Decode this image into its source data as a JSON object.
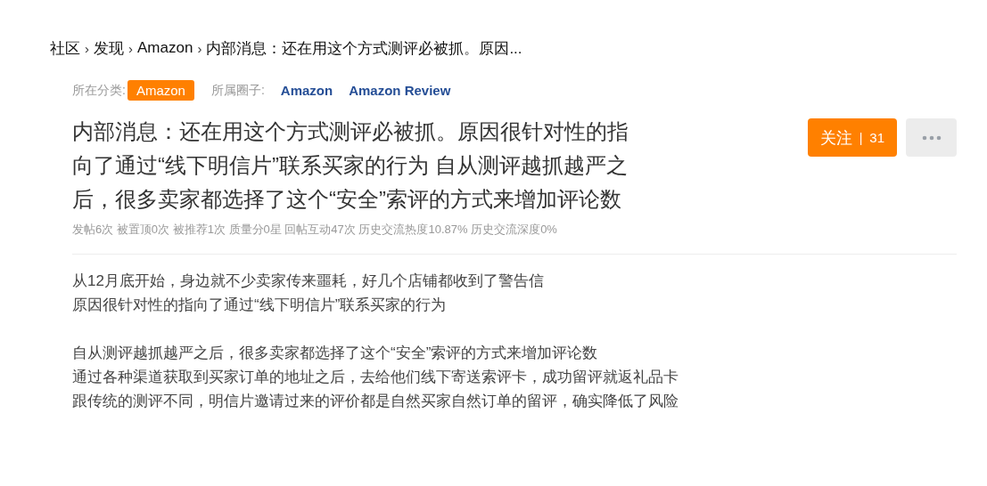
{
  "breadcrumb": [
    {
      "label": "社区"
    },
    {
      "separator": "›",
      "label": "发现"
    },
    {
      "separator": "›",
      "label": "Amazon"
    },
    {
      "separator": "›",
      "label": "内部消息：还在用这个方式测评必被抓。原因..."
    }
  ],
  "meta": {
    "category_label": "所在分类:",
    "category": "Amazon",
    "circles_label": "所属圈子:",
    "circles": [
      "Amazon",
      "Amazon Review"
    ]
  },
  "title": "内部消息：还在用这个方式测评必被抓。原因很针对性的指向了通过“线下明信片”联系买家的行为 自从测评越抓越严之后，很多卖家都选择了这个“安全”索评的方式来增加评论数",
  "follow_button": {
    "label": "关注",
    "separator": "|",
    "count": "31"
  },
  "stats": [
    "发帖6次",
    "被置顶0次",
    "被推荐1次",
    "质量分0星",
    "回帖互动47次",
    "历史交流热度10.87%",
    "历史交流深度0%"
  ],
  "body": [
    [
      "从12月底开始，身边就不少卖家传来噩耗，好几个店铺都收到了警告信",
      "原因很针对性的指向了通过“线下明信片”联系买家的行为"
    ],
    [
      "自从测评越抓越严之后，很多卖家都选择了这个“安全”索评的方式来增加评论数",
      "通过各种渠道获取到买家订单的地址之后，去给他们线下寄送索评卡，成功留评就返礼品卡",
      "跟传统的测评不同，明信片邀请过来的评价都是自然买家自然订单的留评，确实降低了风险"
    ]
  ]
}
